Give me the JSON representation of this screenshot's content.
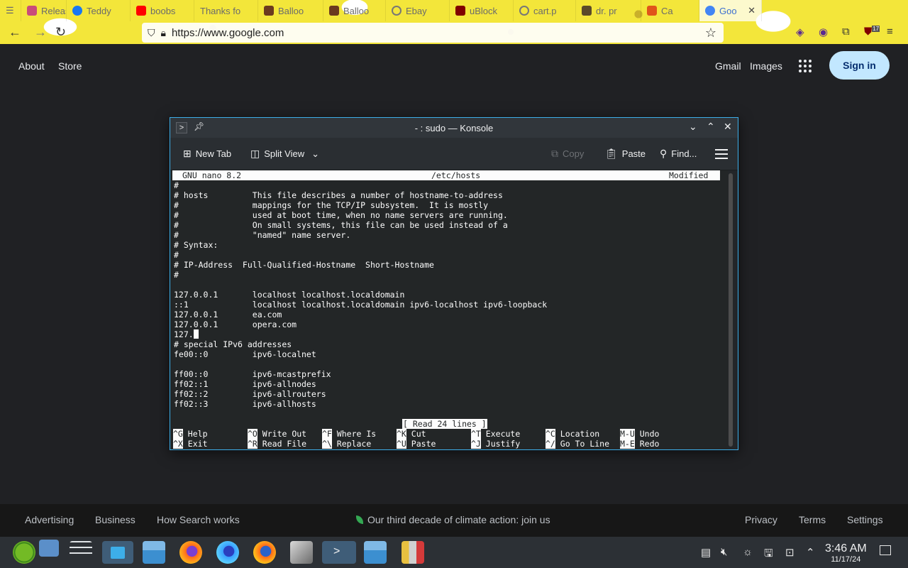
{
  "browser": {
    "tabs": [
      {
        "label": "Releas",
        "color": "#c94c7a"
      },
      {
        "label": "Teddy",
        "color": "#1877f2"
      },
      {
        "label": "boobs",
        "color": "#ff0000"
      },
      {
        "label": "Thanks fo",
        "color": "#9aa0a6"
      },
      {
        "label": "Balloo",
        "color": "#6b3a1f"
      },
      {
        "label": "Balloo",
        "color": "#6b3a1f"
      },
      {
        "label": "Ebay",
        "color": "#888888"
      },
      {
        "label": "uBlock",
        "color": "#800000"
      },
      {
        "label": "cart.p",
        "color": "#9aa0a6"
      },
      {
        "label": "dr. pr",
        "color": "#5a4a2a"
      },
      {
        "label": "Ca",
        "color": "#e0541a"
      },
      {
        "label": "Goo",
        "color": "#4285f4"
      }
    ],
    "url": "https://www.google.com",
    "ext_badge": "17"
  },
  "google": {
    "about": "About",
    "store": "Store",
    "gmail": "Gmail",
    "images": "Images",
    "signin": "Sign in",
    "footer": {
      "advertising": "Advertising",
      "business": "Business",
      "how_search": "How Search works",
      "climate": "Our third decade of climate action: join us",
      "privacy": "Privacy",
      "terms": "Terms",
      "settings": "Settings"
    }
  },
  "konsole": {
    "title": "- : sudo — Konsole",
    "toolbar": {
      "new_tab": "New Tab",
      "split_view": "Split View",
      "copy": "Copy",
      "paste": "Paste",
      "find": "Find..."
    },
    "nano": {
      "version": "GNU nano 8.2",
      "file": "/etc/hosts",
      "state": "Modified",
      "lines": [
        "#",
        "# hosts         This file describes a number of hostname-to-address",
        "#               mappings for the TCP/IP subsystem.  It is mostly",
        "#               used at boot time, when no name servers are running.",
        "#               On small systems, this file can be used instead of a",
        "#               \"named\" name server.",
        "# Syntax:",
        "#",
        "# IP-Address  Full-Qualified-Hostname  Short-Hostname",
        "#",
        "",
        "127.0.0.1       localhost localhost.localdomain",
        "::1             localhost localhost.localdomain ipv6-localhost ipv6-loopback",
        "127.0.0.1       ea.com",
        "127.0.0.1       opera.com",
        "127.",
        "# special IPv6 addresses",
        "fe00::0         ipv6-localnet",
        "",
        "ff00::0         ipv6-mcastprefix",
        "ff02::1         ipv6-allnodes",
        "ff02::2         ipv6-allrouters",
        "ff02::3         ipv6-allhosts"
      ],
      "status": "[ Read 24 lines ]",
      "shortcuts": [
        {
          "key": "^G",
          "label": "Help"
        },
        {
          "key": "^O",
          "label": "Write Out"
        },
        {
          "key": "^F",
          "label": "Where Is"
        },
        {
          "key": "^K",
          "label": "Cut"
        },
        {
          "key": "^T",
          "label": "Execute"
        },
        {
          "key": "^C",
          "label": "Location"
        },
        {
          "key": "M-U",
          "label": "Undo"
        },
        {
          "key": "^X",
          "label": "Exit"
        },
        {
          "key": "^R",
          "label": "Read File"
        },
        {
          "key": "^\\",
          "label": "Replace"
        },
        {
          "key": "^U",
          "label": "Paste"
        },
        {
          "key": "^J",
          "label": "Justify"
        },
        {
          "key": "^/",
          "label": "Go To Line"
        },
        {
          "key": "M-E",
          "label": "Redo"
        }
      ]
    }
  },
  "taskbar": {
    "time": "3:46 AM",
    "date": "11/17/24"
  }
}
